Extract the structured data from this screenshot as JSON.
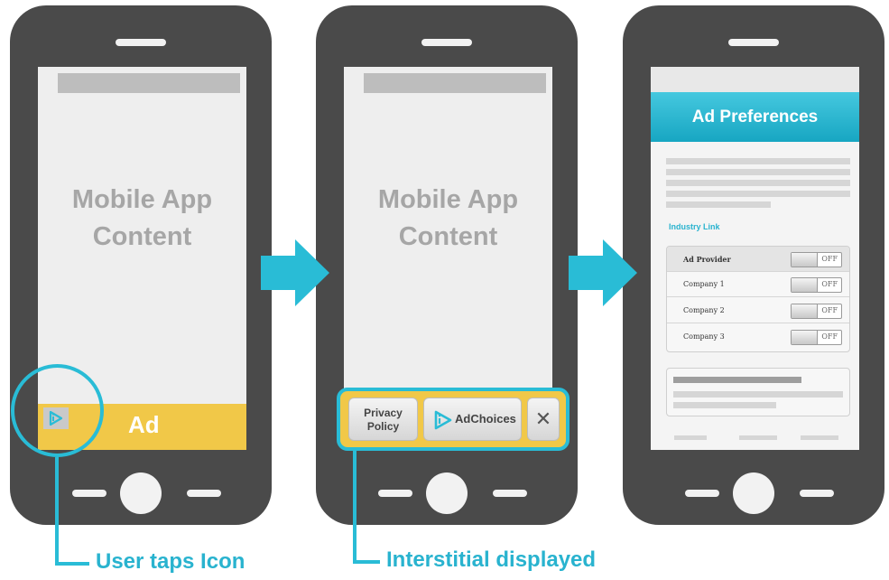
{
  "colors": {
    "phone_body": "#4a4a4a",
    "accent": "#29bcd6",
    "ad_yellow": "#f1c848",
    "screen": "#eeeeee",
    "muted_text": "#a6a6a6"
  },
  "phone1": {
    "content_line1": "Mobile App",
    "content_line2": "Content",
    "ad_label": "Ad",
    "icon": "adchoices-icon"
  },
  "phone2": {
    "content_line1": "Mobile App",
    "content_line2": "Content",
    "interstitial": {
      "privacy_line1": "Privacy",
      "privacy_line2": "Policy",
      "adchoices_label": "AdChoices",
      "close_label": "✕"
    }
  },
  "phone3": {
    "title": "Ad Preferences",
    "industry_link": "Industry Link",
    "rows": [
      {
        "label": "Ad Provider",
        "state": "OFF"
      },
      {
        "label": "Company 1",
        "state": "OFF"
      },
      {
        "label": "Company 2",
        "state": "OFF"
      },
      {
        "label": "Company 3",
        "state": "OFF"
      }
    ]
  },
  "callouts": {
    "step1": "User taps Icon",
    "step2": "Interstitial displayed"
  }
}
